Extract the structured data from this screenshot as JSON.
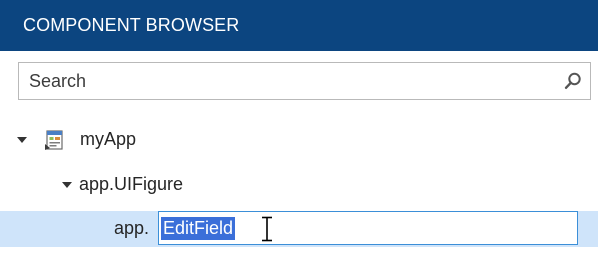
{
  "header": {
    "title": "COMPONENT BROWSER",
    "background": "#0c4580"
  },
  "search": {
    "placeholder": "Search",
    "value": "",
    "icon": "search-icon"
  },
  "tree": {
    "root": {
      "label": "myApp",
      "icon": "app-file-icon",
      "expanded": true
    },
    "figure": {
      "label": "app.UIFigure",
      "expanded": true
    },
    "editing_item": {
      "prefix": "app.",
      "value": "EditField",
      "selected": true,
      "highlight": "#cfe4fa"
    }
  }
}
